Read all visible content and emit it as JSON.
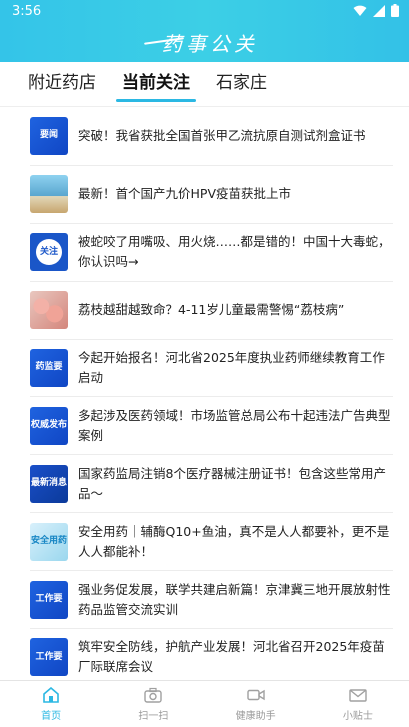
{
  "status_bar": {
    "time": "3:56"
  },
  "header": {
    "logo_text": "药事公关",
    "accent_color": "#34c4e8"
  },
  "tabs": [
    {
      "label": "附近药店",
      "active": false
    },
    {
      "label": "当前关注",
      "active": true
    },
    {
      "label": "石家庄",
      "active": false
    }
  ],
  "news": [
    {
      "thumb_text": "要闻",
      "thumb_style": "blue",
      "title": "突破！我省获批全国首张甲乙流抗原自测试剂盒证书"
    },
    {
      "thumb_text": "",
      "thumb_style": "photo1",
      "title": "最新！首个国产九价HPV疫苗获批上市"
    },
    {
      "thumb_text": "关注",
      "thumb_style": "circle",
      "title": "被蛇咬了用嘴吸、用火烧……都是错的！中国十大毒蛇，你认识吗→"
    },
    {
      "thumb_text": "",
      "thumb_style": "photo2",
      "title": "荔枝越甜越致命？4-11岁儿童最需警惕“荔枝病”"
    },
    {
      "thumb_text": "药监要",
      "thumb_style": "blue",
      "title": "今起开始报名！河北省2025年度执业药师继续教育工作启动"
    },
    {
      "thumb_text": "权威发布",
      "thumb_style": "blue",
      "title": "多起涉及医药领域！市场监管总局公布十起违法广告典型案例"
    },
    {
      "thumb_text": "最新消息",
      "thumb_style": "dark",
      "title": "国家药监局注销8个医疗器械注册证书！包含这些常用产品～"
    },
    {
      "thumb_text": "安全用药",
      "thumb_style": "light",
      "title": "安全用药｜辅酶Q10+鱼油，真不是人人都要补，更不是人人都能补！"
    },
    {
      "thumb_text": "工作要",
      "thumb_style": "blue",
      "title": "强业务促发展，联学共建启新篇！京津冀三地开展放射性药品监管交流实训"
    },
    {
      "thumb_text": "工作要",
      "thumb_style": "blue",
      "title": "筑牢安全防线，护航产业发展！河北省召开2025年疫苗厂际联席会议"
    }
  ],
  "bottom_nav": [
    {
      "label": "首页",
      "icon": "home-icon",
      "active": true
    },
    {
      "label": "扫一扫",
      "icon": "camera-icon",
      "active": false
    },
    {
      "label": "健康助手",
      "icon": "video-icon",
      "active": false
    },
    {
      "label": "小贴士",
      "icon": "mail-icon",
      "active": false
    }
  ]
}
